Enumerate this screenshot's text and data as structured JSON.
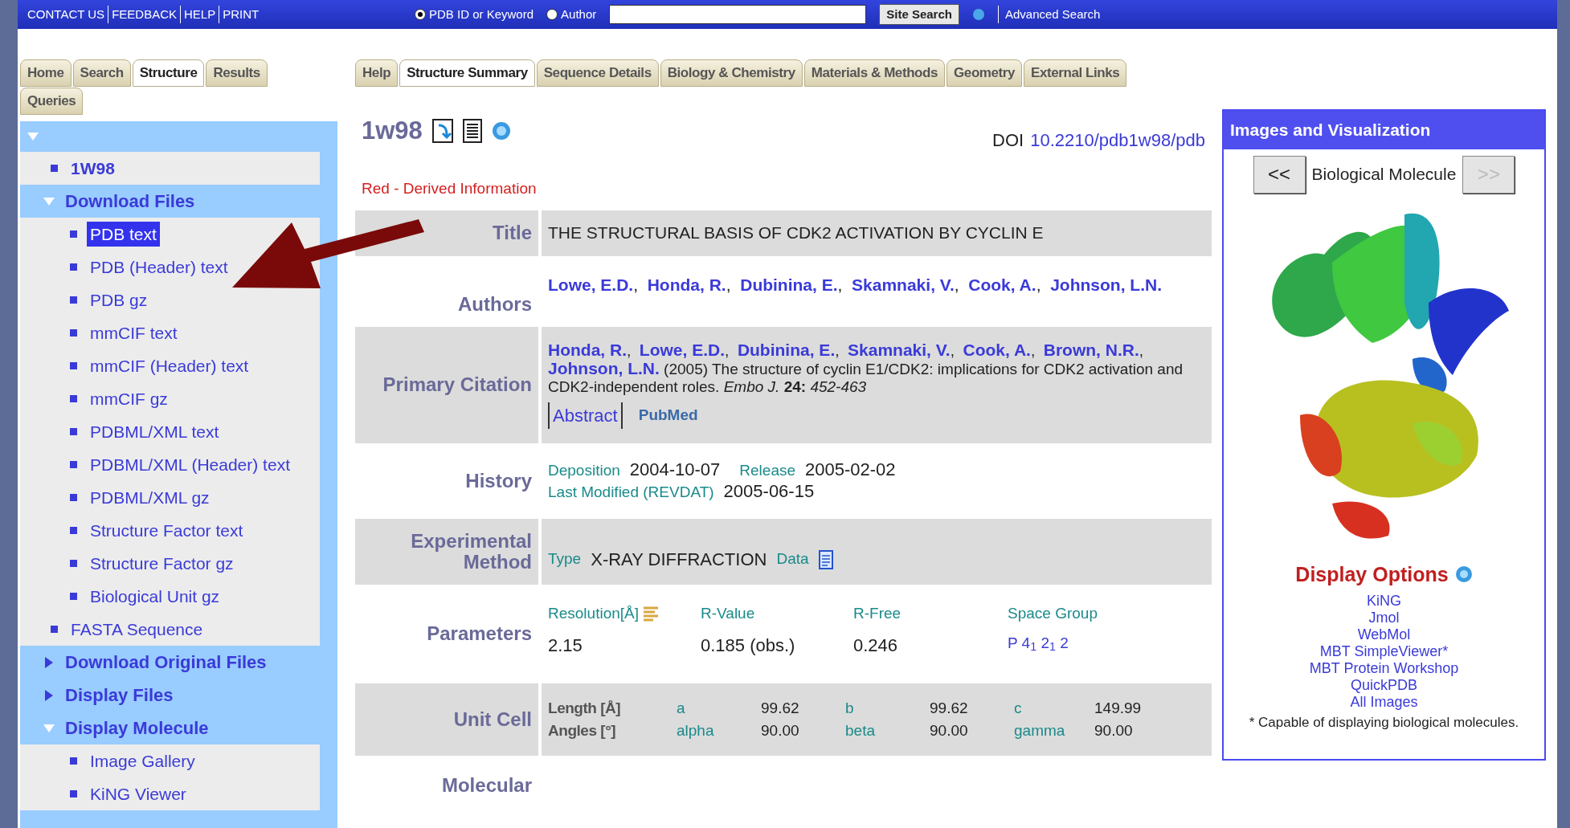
{
  "top_bar": {
    "links": [
      "CONTACT US",
      "FEEDBACK",
      "HELP",
      "PRINT"
    ],
    "search_modes": [
      {
        "label": "PDB ID or Keyword",
        "selected": true
      },
      {
        "label": "Author",
        "selected": false
      }
    ],
    "search_button": "Site Search",
    "advanced_link": "Advanced Search"
  },
  "left_tabs": [
    {
      "label": "Home",
      "selected": false
    },
    {
      "label": "Search",
      "selected": false
    },
    {
      "label": "Structure",
      "selected": true
    },
    {
      "label": "Results",
      "selected": false
    },
    {
      "label": "Queries",
      "selected": false
    }
  ],
  "tree": {
    "expanded": true,
    "items": [
      {
        "kind": "entry",
        "label": "1W98",
        "selected": false
      },
      {
        "kind": "folder",
        "label": "Download Files",
        "expanded": true,
        "children": [
          {
            "kind": "leaf",
            "label": "PDB text",
            "selected": true
          },
          {
            "kind": "leaf",
            "label": "PDB (Header) text",
            "selected": false
          },
          {
            "kind": "leaf",
            "label": "PDB gz",
            "selected": false
          },
          {
            "kind": "leaf",
            "label": "mmCIF text",
            "selected": false
          },
          {
            "kind": "leaf",
            "label": "mmCIF (Header) text",
            "selected": false
          },
          {
            "kind": "leaf",
            "label": "mmCIF gz",
            "selected": false
          },
          {
            "kind": "leaf",
            "label": "PDBML/XML text",
            "selected": false
          },
          {
            "kind": "leaf",
            "label": "PDBML/XML (Header) text",
            "selected": false
          },
          {
            "kind": "leaf",
            "label": "PDBML/XML gz",
            "selected": false
          },
          {
            "kind": "leaf",
            "label": "Structure Factor text",
            "selected": false
          },
          {
            "kind": "leaf",
            "label": "Structure Factor gz",
            "selected": false
          },
          {
            "kind": "leaf",
            "label": "Biological Unit gz",
            "selected": false
          }
        ]
      },
      {
        "kind": "leaf",
        "label": "FASTA Sequence",
        "selected": false
      },
      {
        "kind": "folder",
        "label": "Download Original Files",
        "expanded": false
      },
      {
        "kind": "folder",
        "label": "Display Files",
        "expanded": false
      },
      {
        "kind": "folder",
        "label": "Display Molecule",
        "expanded": true,
        "children": [
          {
            "kind": "leaf",
            "label": "Image Gallery",
            "selected": false
          },
          {
            "kind": "leaf",
            "label": "KiNG Viewer",
            "selected": false
          }
        ]
      }
    ]
  },
  "page_tabs": [
    {
      "label": "Help",
      "selected": false
    },
    {
      "label": "Structure Summary",
      "selected": true
    },
    {
      "label": "Sequence Details",
      "selected": false
    },
    {
      "label": "Biology & Chemistry",
      "selected": false
    },
    {
      "label": "Materials & Methods",
      "selected": false
    },
    {
      "label": "Geometry",
      "selected": false
    },
    {
      "label": "External Links",
      "selected": false
    }
  ],
  "entry": {
    "id": "1w98",
    "doi_label": "DOI",
    "doi": "10.2210/pdb1w98/pdb",
    "legend": "Red - Derived Information"
  },
  "rows": [
    {
      "kind": "title",
      "label": "Title",
      "value": "THE STRUCTURAL BASIS OF CDK2 ACTIVATION BY CYCLIN E"
    },
    {
      "kind": "authors",
      "label": "Authors",
      "separator": ",",
      "authors": [
        "Lowe, E.D.",
        "Honda, R.",
        "Dubinina, E.",
        "Skamnaki, V.",
        "Cook, A.",
        "Johnson, L.N."
      ]
    },
    {
      "kind": "citation",
      "label": "Primary Citation",
      "separator": ",",
      "authors": [
        "Honda, R.",
        "Lowe, E.D.",
        "Dubinina, E.",
        "Skamnaki, V.",
        "Cook, A.",
        "Brown, N.R.",
        "Johnson, L.N."
      ],
      "text": "(2005) The structure of cyclin E1/CDK2: implications for CDK2 activation and CDK2-independent roles.  *Embo J.*  **24:** *452-463*",
      "abstract": "Abstract",
      "pubmed": "PubMed"
    },
    {
      "kind": "history",
      "label": "History",
      "items": [
        {
          "name": "Deposition",
          "value": "2004-10-07"
        },
        {
          "name": "Release",
          "value": "2005-02-02"
        },
        {
          "name": "Last Modified (REVDAT)",
          "value": "2005-06-15"
        }
      ]
    },
    {
      "kind": "method",
      "label": "Experimental Method",
      "type_label": "Type",
      "value": "X-RAY DIFFRACTION",
      "data_label": "Data"
    },
    {
      "kind": "parameters",
      "label": "Parameters",
      "items": [
        {
          "kind": "resolution",
          "name": "Resolution[Å]",
          "value": "2.15"
        },
        {
          "kind": "plain",
          "name": "R-Value",
          "value": "0.185 (obs.)"
        },
        {
          "kind": "plain",
          "name": "R-Free",
          "value": "0.246"
        },
        {
          "kind": "link",
          "name": "Space Group",
          "value": "P 4$_{1}$ 2$_{1}$ 2"
        }
      ]
    },
    {
      "kind": "unit_cell",
      "label": "Unit Cell",
      "row_labels": [
        "Length [Å]",
        "Angles [°]"
      ],
      "lengths": [
        {
          "name": "a",
          "value": "99.62"
        },
        {
          "name": "b",
          "value": "99.62"
        },
        {
          "name": "c",
          "value": "149.99"
        }
      ],
      "angles": [
        {
          "name": "alpha",
          "value": "90.00"
        },
        {
          "name": "beta",
          "value": "90.00"
        },
        {
          "name": "gamma",
          "value": "90.00"
        }
      ]
    },
    {
      "kind": "label_only",
      "label": "Molecular"
    }
  ],
  "visualization": {
    "title": "Images and Visualization",
    "prev": {
      "label": "<<",
      "disabled": false
    },
    "view": "Biological Molecule",
    "next": {
      "label": ">>",
      "disabled": true
    },
    "options_title": "Display Options",
    "options": [
      "KiNG",
      "Jmol",
      "WebMol",
      "MBT SimpleViewer*",
      "MBT Protein Workshop",
      "QuickPDB",
      "All Images"
    ],
    "note": "* Capable of displaying biological molecules."
  }
}
